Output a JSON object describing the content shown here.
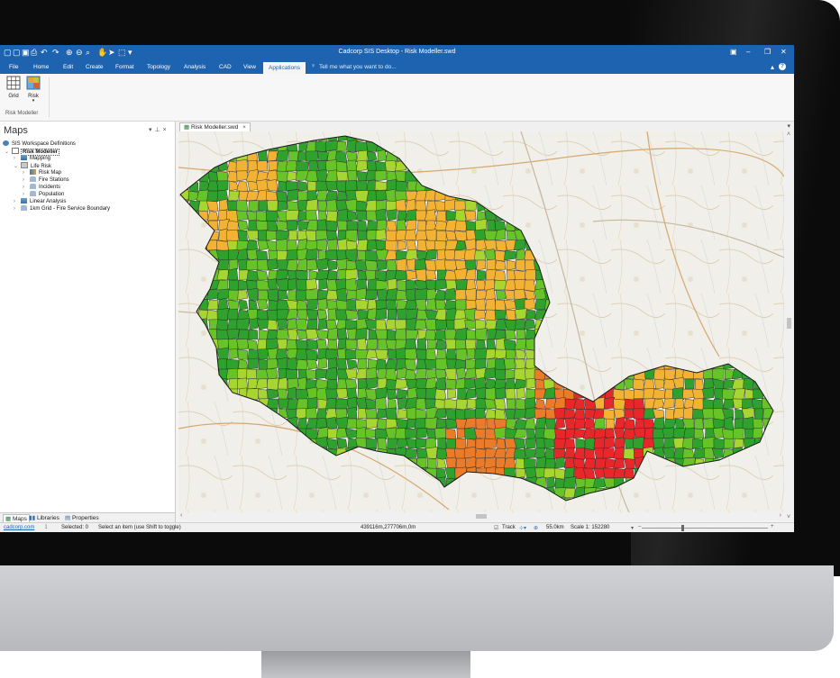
{
  "window": {
    "title": "Cadcorp SIS Desktop - Risk Modeller.swd"
  },
  "ribbon": {
    "tabs": [
      {
        "label": "File"
      },
      {
        "label": "Home"
      },
      {
        "label": "Edit"
      },
      {
        "label": "Create"
      },
      {
        "label": "Format"
      },
      {
        "label": "Topology"
      },
      {
        "label": "Analysis"
      },
      {
        "label": "CAD"
      },
      {
        "label": "View"
      },
      {
        "label": "Applications"
      }
    ],
    "active_tab": "Applications",
    "tell_me": "Tell me what you want to do...",
    "buttons": [
      {
        "label": "Grid",
        "icon": "grid-icon"
      },
      {
        "label": "Risk",
        "icon": "risk-map-icon"
      }
    ],
    "group_label": "Risk Modeller"
  },
  "panel": {
    "title": "Maps",
    "tree": [
      {
        "label": "SIS Workspace Definitions",
        "icon": "workspace-icon"
      },
      {
        "label": "Risk Modeller",
        "icon": "map-icon"
      },
      {
        "label": "Mapping",
        "icon": "layers-icon"
      },
      {
        "label": "Life Risk",
        "icon": "folder-icon"
      },
      {
        "label": "Risk Map",
        "icon": "theme-icon"
      },
      {
        "label": "Fire Stations",
        "icon": "overlay-icon"
      },
      {
        "label": "Incidents",
        "icon": "overlay-icon"
      },
      {
        "label": "Population",
        "icon": "overlay-icon"
      },
      {
        "label": "Linear Analysis",
        "icon": "layers-icon"
      },
      {
        "label": "1km Grid - Fire Service Boundary",
        "icon": "overlay-icon"
      }
    ],
    "bottom_tabs": [
      {
        "label": "Maps",
        "icon": "maps-icon"
      },
      {
        "label": "Libraries",
        "icon": "libraries-icon"
      },
      {
        "label": "Properties",
        "icon": "properties-icon"
      }
    ]
  },
  "document": {
    "tab_label": "Risk Modeller.swd"
  },
  "map": {
    "risk_colors": {
      "low": "#2ea22c",
      "low_mid": "#66c428",
      "mid": "#a8d631",
      "mid_high": "#f2b234",
      "high": "#ea7b28",
      "very_high": "#e8272b"
    }
  },
  "status": {
    "link": "cadcorp.com",
    "selected": "Selected: 0",
    "hint": "Select an item (use Shift to toggle)",
    "coords": "439116m,277706m,0m",
    "track": "Track",
    "distance": "55.0km",
    "scale": "Scale 1: 152280"
  }
}
